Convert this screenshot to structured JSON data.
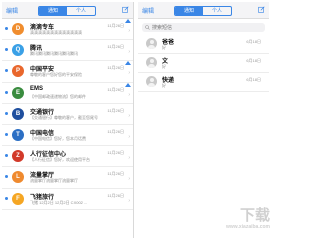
{
  "left": {
    "nav": {
      "edit": "编辑",
      "tabs": [
        "通知",
        "个人"
      ]
    },
    "items": [
      {
        "name": "滴滴专车",
        "date": "11月26日",
        "preview": "滴滴滴滴滴滴滴滴滴滴滴滴滴",
        "avatar": "D",
        "color": "#f08d2e",
        "flag": true
      },
      {
        "name": "腾讯",
        "date": "11月26日",
        "preview": "腾讯腾讯腾讯腾讯腾讯腾讯",
        "avatar": "Q",
        "color": "#3aa0e6",
        "flag": false
      },
      {
        "name": "中国平安",
        "date": "11月26日",
        "preview": "尊敬的客户您好您的平安保险",
        "avatar": "P",
        "color": "#e9672c",
        "flag": true
      },
      {
        "name": "EMS",
        "date": "11月26日",
        "preview": "【中国邮政速递物流】您的邮件",
        "avatar": "E",
        "color": "#3a8c3f",
        "flag": true
      },
      {
        "name": "交通银行",
        "date": "11月26日",
        "preview": "【交通银行】尊敬的客户，截至您尾号",
        "avatar": "B",
        "color": "#1f4f9e",
        "flag": false
      },
      {
        "name": "中国电信",
        "date": "11月26日",
        "preview": "【中国电信】您好，您本月话费",
        "avatar": "T",
        "color": "#2c6fc4",
        "flag": false
      },
      {
        "name": "人行征信中心",
        "date": "11月26日",
        "preview": "【人行征信】您好，欢迎使用平台",
        "avatar": "Z",
        "color": "#d23a2a",
        "flag": false
      },
      {
        "name": "流量掌厅",
        "date": "11月26日",
        "preview": "流量掌厅流量掌厅流量掌厅",
        "avatar": "L",
        "color": "#ef8a2f",
        "flag": false
      },
      {
        "name": "飞猪旅行",
        "date": "11月26日",
        "preview": "飞猪 12月2日 12月2日 CX002 ...",
        "avatar": "F",
        "color": "#f5a623",
        "flag": false
      }
    ]
  },
  "right": {
    "nav": {
      "edit": "编辑",
      "tabs": [
        "通知",
        "个人"
      ]
    },
    "search": {
      "placeholder": "搜索短信"
    },
    "contacts": [
      {
        "name": "爸爸",
        "preview": "好",
        "date": "6月18日"
      },
      {
        "name": "文",
        "preview": "好",
        "date": "6月18日"
      },
      {
        "name": "快递",
        "preview": "好",
        "date": "6月18日"
      }
    ]
  },
  "watermark": {
    "main": "下载",
    "sub": "www.xiazaiba.com"
  },
  "colors": {
    "accent": "#3a86e6"
  }
}
